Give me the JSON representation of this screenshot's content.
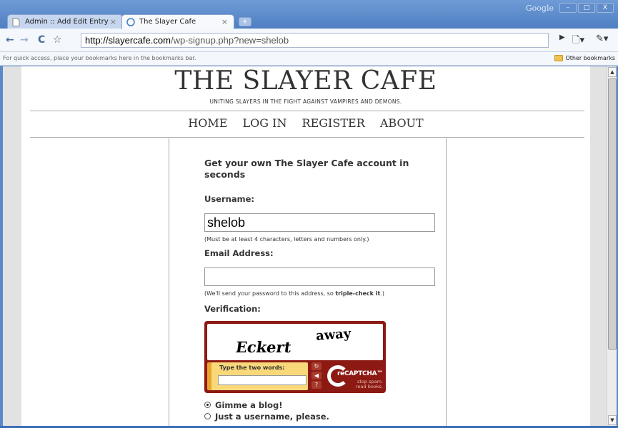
{
  "browser": {
    "tabs": [
      {
        "label": "Admin :: Add Edit Entry Write",
        "close": "×"
      },
      {
        "label": "The Slayer Cafe",
        "close": "×"
      }
    ],
    "new_tab": "+",
    "google_label": "Google",
    "window_buttons": [
      "–",
      "□",
      "X"
    ],
    "url_host": "http://slayercafe.com",
    "url_path": "/wp-signup.php?new=shelob",
    "bookmarks_hint": "For quick access, place your bookmarks here in the bookmarks bar.",
    "other_bookmarks": "Other bookmarks"
  },
  "site": {
    "title": "THE SLAYER CAFE",
    "tagline": "UNITING SLAYERS IN THE FIGHT AGAINST VAMPIRES AND DEMONS.",
    "nav": [
      "HOME",
      "LOG IN",
      "REGISTER",
      "ABOUT"
    ]
  },
  "form": {
    "heading": "Get your own The Slayer Cafe account in seconds",
    "username_label": "Username:",
    "username_value": "shelob",
    "username_hint": "(Must be at least 4 characters, letters and numbers only.)",
    "email_label": "Email Address:",
    "email_value": "",
    "email_hint_prefix": "(We'll send your password to this address, so ",
    "email_hint_bold": "triple-check it",
    "email_hint_suffix": ".)",
    "verification_label": "Verification:",
    "captcha": {
      "word1": "Eckert",
      "word2": "away",
      "type_label": "Type the two words:",
      "brand": "reCAPTCHA™",
      "slogan_line1": "stop spam.",
      "slogan_line2": "read books."
    },
    "radio_blog": "Gimme a blog!",
    "radio_username": "Just a username, please.",
    "selected_option": "Gimme a blog!"
  }
}
